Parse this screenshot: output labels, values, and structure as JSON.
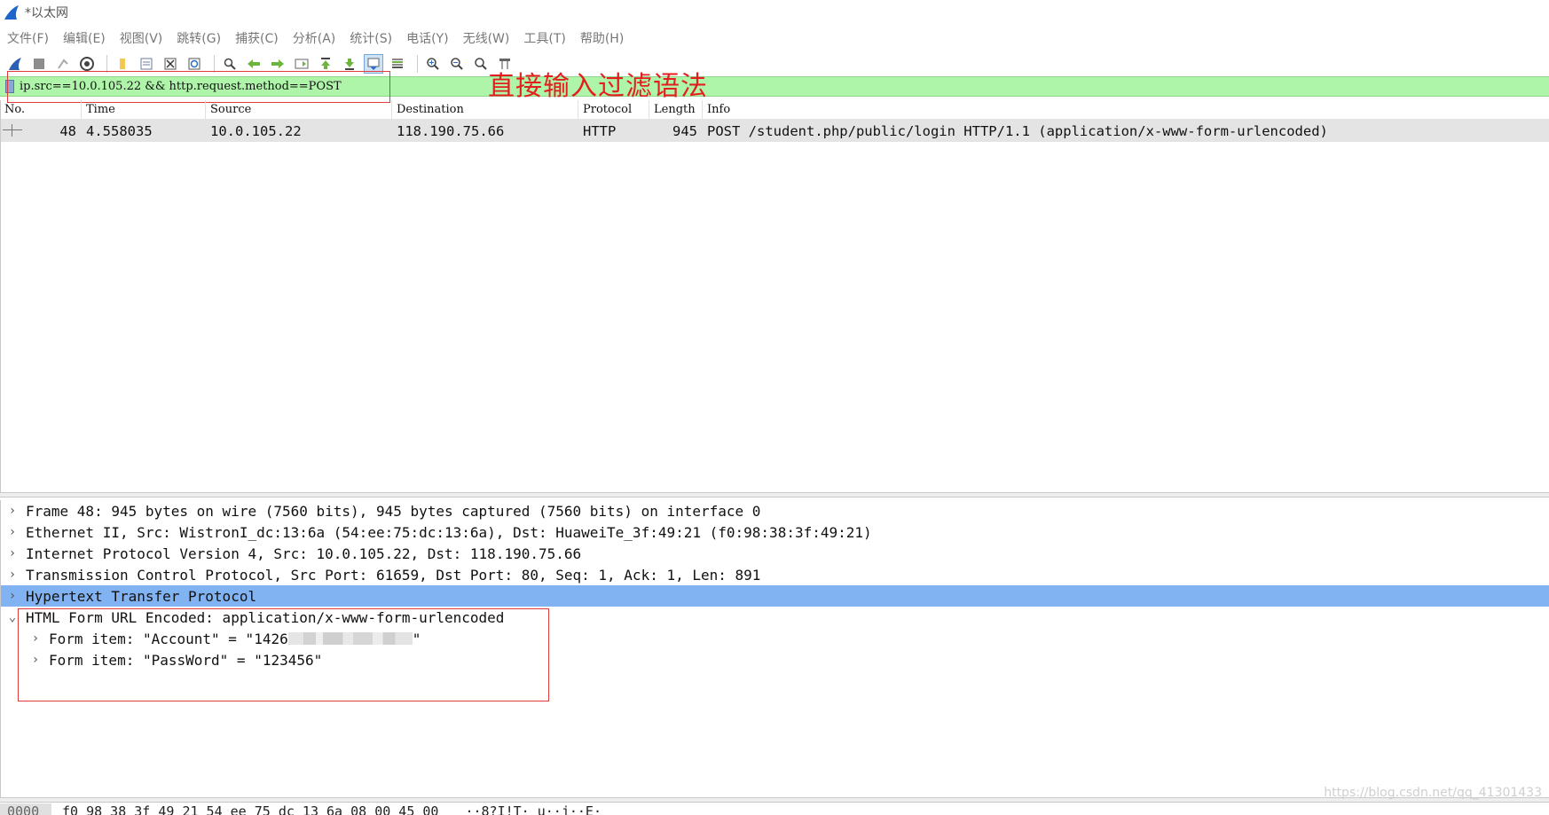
{
  "window": {
    "title": "*以太网"
  },
  "menu": [
    "文件(F)",
    "编辑(E)",
    "视图(V)",
    "跳转(G)",
    "捕获(C)",
    "分析(A)",
    "统计(S)",
    "电话(Y)",
    "无线(W)",
    "工具(T)",
    "帮助(H)"
  ],
  "filter": {
    "expression": "ip.src==10.0.105.22 && http.request.method==POST"
  },
  "annotation": "直接输入过滤语法",
  "packet_list": {
    "columns": [
      "No.",
      "Time",
      "Source",
      "Destination",
      "Protocol",
      "Length",
      "Info"
    ],
    "rows": [
      {
        "no": "48",
        "time": "4.558035",
        "source": "10.0.105.22",
        "destination": "118.190.75.66",
        "protocol": "HTTP",
        "length": "945",
        "info": "POST /student.php/public/login HTTP/1.1  (application/x-www-form-urlencoded)"
      }
    ]
  },
  "details": {
    "frame": "Frame 48: 945 bytes on wire (7560 bits), 945 bytes captured (7560 bits) on interface 0",
    "ethernet": "Ethernet II, Src: WistronI_dc:13:6a (54:ee:75:dc:13:6a), Dst: HuaweiTe_3f:49:21 (f0:98:38:3f:49:21)",
    "ip": "Internet Protocol Version 4, Src: 10.0.105.22, Dst: 118.190.75.66",
    "tcp": "Transmission Control Protocol, Src Port: 61659, Dst Port: 80, Seq: 1, Ack: 1, Len: 891",
    "http": "Hypertext Transfer Protocol",
    "form": "HTML Form URL Encoded: application/x-www-form-urlencoded",
    "form_item_account_prefix": "Form item: \"Account\" = \"1426",
    "form_item_account_suffix": "\"",
    "form_item_password": "Form item: \"PassWord\" = \"123456\""
  },
  "hex": {
    "offset": "0000",
    "bytes": "f0 98 38 3f 49 21 54 ee  75 dc 13 6a 08 00 45 00",
    "ascii": "··8?I!T· u··j··E·"
  },
  "watermark": "https://blog.csdn.net/qq_41301433",
  "icons": [
    "shark-fin-icon",
    "stop-icon",
    "restart-icon",
    "options-icon",
    "open-icon",
    "save-icon",
    "close-file-icon",
    "reload-icon",
    "find-icon",
    "back-icon",
    "forward-icon",
    "goto-icon",
    "first-icon",
    "last-icon",
    "autoscroll-icon",
    "colorize-icon",
    "zoom-in-icon",
    "zoom-out-icon",
    "zoom-normal-icon",
    "resize-columns-icon"
  ],
  "colors": {
    "filter_valid": "#aff5a9",
    "selected_detail": "#81b3f2",
    "annotation": "#e41e1e"
  }
}
